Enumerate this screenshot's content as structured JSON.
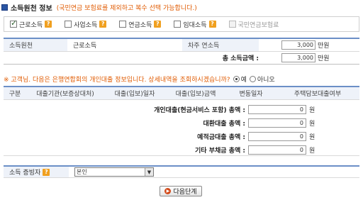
{
  "header": {
    "title": "소득원천 정보",
    "note": "(국민연금 보험료를 제외하고 복수 선택 가능합니다.)"
  },
  "income_sources": [
    {
      "label": "근로소득",
      "checked": true,
      "enabled": true
    },
    {
      "label": "사업소득",
      "checked": false,
      "enabled": true
    },
    {
      "label": "연금소득",
      "checked": false,
      "enabled": true
    },
    {
      "label": "임대소득",
      "checked": false,
      "enabled": true
    },
    {
      "label": "국민연금보험료",
      "checked": false,
      "enabled": false
    }
  ],
  "help_icon": "?",
  "income_table": {
    "source_header": "소득원천",
    "source_value": "근로소득",
    "annual_header": "차주 연소득",
    "annual_value": "3,000",
    "annual_unit": "만원",
    "total_label": "총 소득금액 :",
    "total_value": "3,000",
    "total_unit": "만원"
  },
  "notice": {
    "text": "※ 고객님. 다음은 은행연합회의 개인대출 정보입니다. 상세내역을 조회하시겠습니까?",
    "yes_label": "예",
    "no_label": "아니오",
    "selected": "예"
  },
  "loan_table": {
    "columns": [
      "구분",
      "대출기관(보증상대처)",
      "대출(입보)일자",
      "대출(입보)금액",
      "변동일자",
      "주택담보대출여부"
    ],
    "totals": [
      {
        "label": "개인대출(현금서비스 포함) 총액 :",
        "value": "0",
        "unit": "원"
      },
      {
        "label": "대환대출 총액 :",
        "value": "0",
        "unit": "원"
      },
      {
        "label": "예적금대출 총액 :",
        "value": "0",
        "unit": "원"
      },
      {
        "label": "기타 부채금 총액 :",
        "value": "0",
        "unit": "원"
      }
    ]
  },
  "proof": {
    "label": "소득 증빙자",
    "selected": "본인"
  },
  "next_button": {
    "label": "다음단계"
  },
  "colors": {
    "accent": "#6b8fc7",
    "notice": "#e05a00",
    "header_bg": "#eef2f9"
  }
}
